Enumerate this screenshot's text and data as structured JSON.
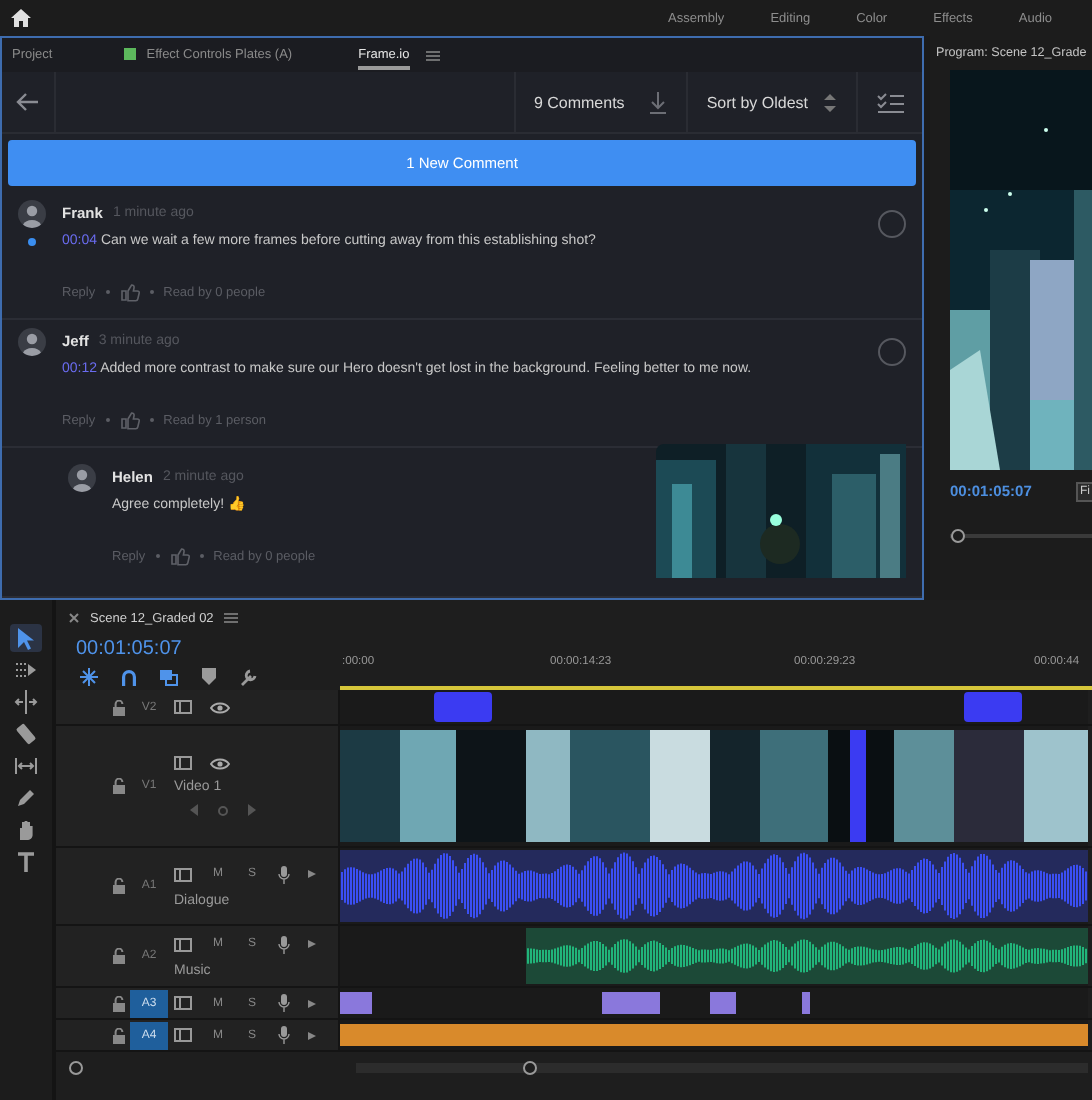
{
  "workspaces": [
    {
      "label": "Assembly"
    },
    {
      "label": "Editing"
    },
    {
      "label": "Color"
    },
    {
      "label": "Effects"
    },
    {
      "label": "Audio"
    }
  ],
  "panel_tabs": [
    {
      "label": "Project",
      "selected": false
    },
    {
      "label": "Effect Controls Plates (A)",
      "selected": false,
      "color": "#5cb85c"
    },
    {
      "label": "Frame.io",
      "selected": true
    }
  ],
  "frameio": {
    "comment_count": "9 Comments",
    "sort": "Sort by Oldest",
    "new_comments_button": "1 New Comment",
    "comments": [
      {
        "author": "Frank",
        "time": "1 minute ago",
        "timecode": "00:04",
        "text": "Can we wait a few more frames before cutting away from this establishing shot?",
        "unread": true,
        "resolved": false,
        "reply": "Reply",
        "read_by": "Read by 0 people"
      },
      {
        "author": "Jeff",
        "time": "3 minute ago",
        "timecode": "00:12",
        "text": "Added more contrast to make sure our Hero doesn't get lost in the background. Feeling better to me now.",
        "unread": false,
        "resolved": false,
        "reply": "Reply",
        "read_by": "Read by 1 person",
        "replies": [
          {
            "author": "Helen",
            "time": "2 minute ago",
            "text": "Agree completely! 👍",
            "reply": "Reply",
            "read_by": "Read by 0 people"
          }
        ]
      }
    ]
  },
  "program": {
    "title": "Program: Scene 12_Grade",
    "timecode": "00:01:05:07",
    "fit": "Fi"
  },
  "tools": [
    {
      "kind": "selection",
      "selected": true
    },
    {
      "kind": "track-select",
      "selected": false
    },
    {
      "kind": "ripple",
      "selected": false
    },
    {
      "kind": "razor",
      "selected": false
    },
    {
      "kind": "slip",
      "selected": false
    },
    {
      "kind": "pen",
      "selected": false
    },
    {
      "kind": "hand",
      "selected": false
    },
    {
      "kind": "type",
      "selected": false
    }
  ],
  "timeline": {
    "sequence": "Scene 12_Graded 02",
    "timecode": "00:01:05:07",
    "toolbar": [
      {
        "kind": "snap",
        "on": true
      },
      {
        "kind": "magnet",
        "on": true
      },
      {
        "kind": "linked",
        "on": true
      },
      {
        "kind": "marker",
        "on": false
      },
      {
        "kind": "wrench",
        "on": false
      }
    ],
    "ruler": [
      ":00:00",
      "00:00:14:23",
      "00:00:29:23",
      "00:00:44"
    ],
    "tracks": [
      {
        "id": "V2",
        "kind": "video",
        "targeted": false,
        "color": "#3b3bf2"
      },
      {
        "id": "V1",
        "kind": "video",
        "targeted": false,
        "name": "Video 1"
      },
      {
        "id": "A1",
        "kind": "audio",
        "targeted": false,
        "name": "Dialogue",
        "buttons": [
          "M",
          "S"
        ],
        "color": "#3b4ff5"
      },
      {
        "id": "A2",
        "kind": "audio",
        "targeted": false,
        "name": "Music",
        "buttons": [
          "M",
          "S"
        ],
        "color": "#21b57a"
      },
      {
        "id": "A3",
        "kind": "audio",
        "targeted": true,
        "buttons": [
          "M",
          "S"
        ],
        "color": "#8a78dc"
      },
      {
        "id": "A4",
        "kind": "audio",
        "targeted": true,
        "buttons": [
          "M",
          "S"
        ],
        "color": "#d98a2b"
      }
    ]
  }
}
